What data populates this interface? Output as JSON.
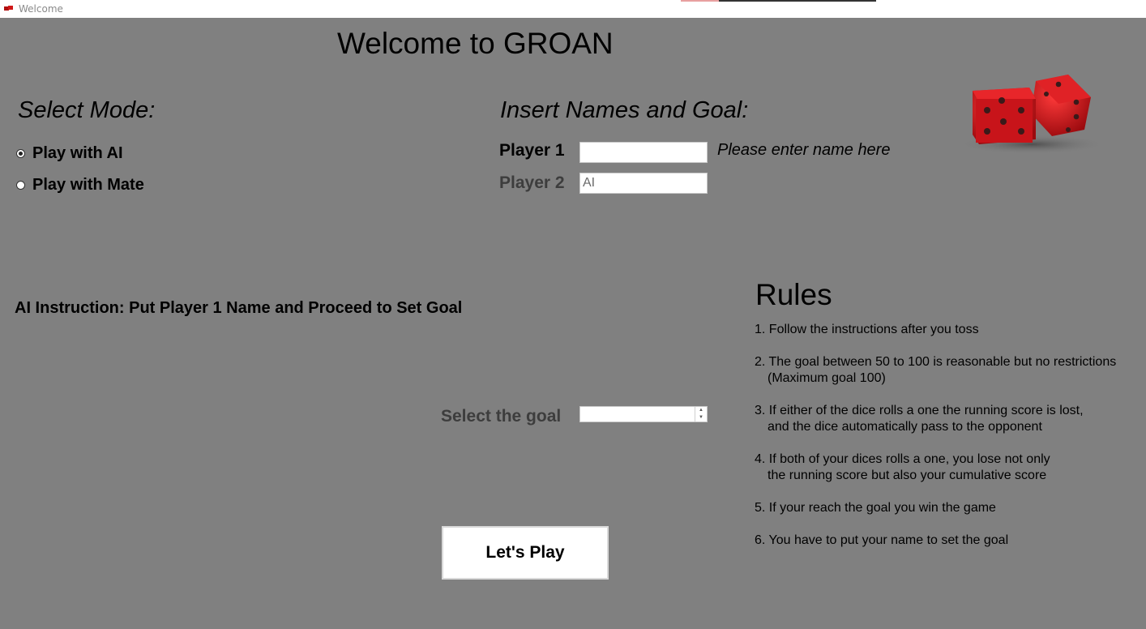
{
  "window": {
    "title": "Welcome"
  },
  "main_title": "Welcome to GROAN",
  "mode": {
    "heading": "Select Mode:",
    "options": [
      {
        "label": "Play with AI",
        "checked": true
      },
      {
        "label": "Play with Mate",
        "checked": false
      }
    ]
  },
  "names": {
    "heading": "Insert Names and Goal:",
    "player1": {
      "label": "Player 1",
      "value": "",
      "hint": "Please enter name here"
    },
    "player2": {
      "label": "Player 2",
      "value": "AI"
    }
  },
  "instruction": "AI Instruction: Put Player 1 Name and Proceed to Set Goal",
  "goal": {
    "label": "Select the goal",
    "value": ""
  },
  "play_button": "Let's Play",
  "rules": {
    "title": "Rules",
    "items": [
      {
        "line1": "1. Follow the instructions after you toss",
        "line2": ""
      },
      {
        "line1": "2. The goal between 50 to 100 is reasonable but no restrictions",
        "line2": "(Maximum goal 100)"
      },
      {
        "line1": "3. If either of the dice rolls a one the running score is lost,",
        "line2": "and the dice automatically pass to the opponent"
      },
      {
        "line1": "4. If both of your dices rolls a one, you lose not only",
        "line2": "the running score but also your cumulative score"
      },
      {
        "line1": "5. If your reach the goal you win the game",
        "line2": ""
      },
      {
        "line1": "6. You have to put your name to set the goal",
        "line2": ""
      }
    ]
  },
  "colors": {
    "background": "#808080",
    "dice": "#c8141a"
  }
}
